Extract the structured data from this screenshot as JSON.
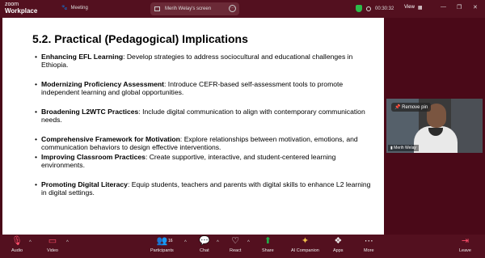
{
  "titlebar": {
    "brand_line1": "zoom",
    "brand_line2": "Workplace",
    "meeting_label": "Meeting",
    "screen_share_label": "Merih Welay's screen",
    "timer": "00:30:32",
    "view_label": "View"
  },
  "slide": {
    "title": "5.2. Practical (Pedagogical) Implications",
    "bullets": [
      {
        "bold": "Enhancing EFL Learning",
        "text": ": Develop strategies to address sociocultural and educational challenges in Ethiopia."
      },
      {
        "bold": "Modernizing Proficiency Assessment",
        "text": ": Introduce CEFR-based self-assessment tools to promote independent learning and global opportunities."
      },
      {
        "bold": "Broadening L2WTC Practices",
        "text": ": Include digital communication to align with contemporary communication needs."
      },
      {
        "bold": "Comprehensive Framework for Motivation",
        "text": ": Explore relationships between motivation, emotions, and communication behaviors to design effective interventions."
      },
      {
        "bold": "Improving Classroom Practices",
        "text": ": Create supportive, interactive, and student-centered learning environments."
      },
      {
        "bold": "Promoting Digital Literacy",
        "text": ": Equip students, teachers and parents with digital skills to enhance L2 learning in digital settings."
      }
    ]
  },
  "participant": {
    "remove_pin": "Remove pin",
    "name": "Merih Welay"
  },
  "toolbar": {
    "audio": "Audio",
    "video": "Video",
    "participants": "Participants",
    "participants_count": "16",
    "chat": "Chat",
    "react": "React",
    "share": "Share",
    "ai_companion": "AI Companion",
    "apps": "Apps",
    "more": "More",
    "leave": "Leave"
  },
  "colors": {
    "window_bg": "#4a0918",
    "bar_bg": "#53101f",
    "share_green": "#1fb34a",
    "shield_green": "#2dbb4a",
    "mute_red": "#ff4d6a"
  }
}
